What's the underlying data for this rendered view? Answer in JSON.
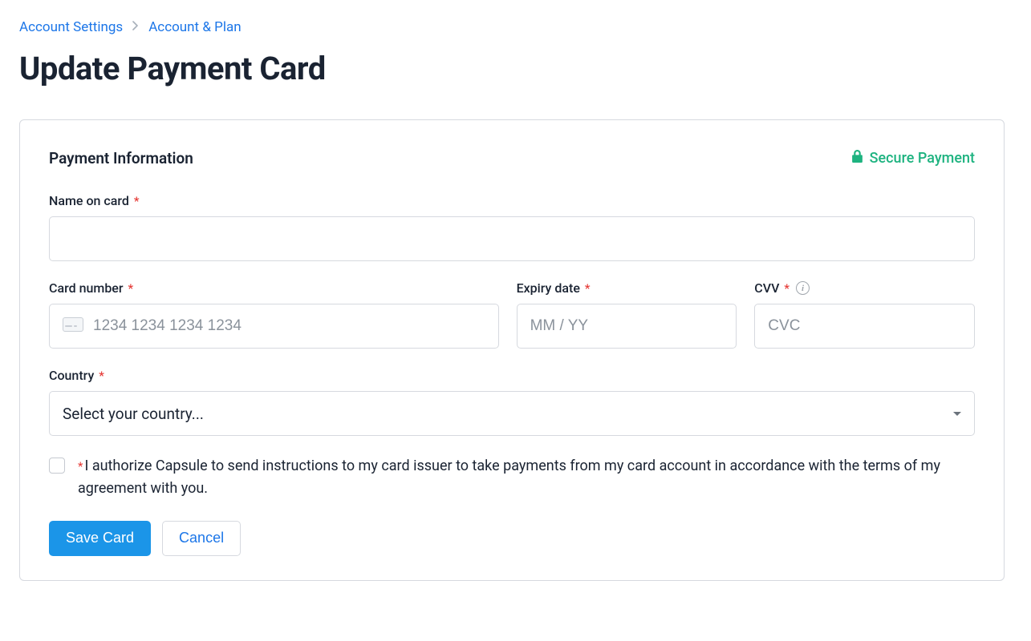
{
  "breadcrumb": {
    "items": [
      {
        "label": "Account Settings"
      },
      {
        "label": "Account & Plan"
      }
    ]
  },
  "page_title": "Update Payment Card",
  "panel": {
    "heading": "Payment Information",
    "secure_label": "Secure Payment"
  },
  "fields": {
    "name_on_card": {
      "label": "Name on card",
      "value": ""
    },
    "card_number": {
      "label": "Card number",
      "placeholder": "1234 1234 1234 1234",
      "value": ""
    },
    "expiry": {
      "label": "Expiry date",
      "placeholder": "MM / YY",
      "value": ""
    },
    "cvv": {
      "label": "CVV",
      "placeholder": "CVC",
      "value": ""
    },
    "country": {
      "label": "Country",
      "placeholder": "Select your country..."
    }
  },
  "consent": {
    "text": "I authorize Capsule to send instructions to my card issuer to take payments from my card account in accordance with the terms of my agreement with you.",
    "checked": false
  },
  "buttons": {
    "save": "Save Card",
    "cancel": "Cancel"
  },
  "required_marker": "*"
}
